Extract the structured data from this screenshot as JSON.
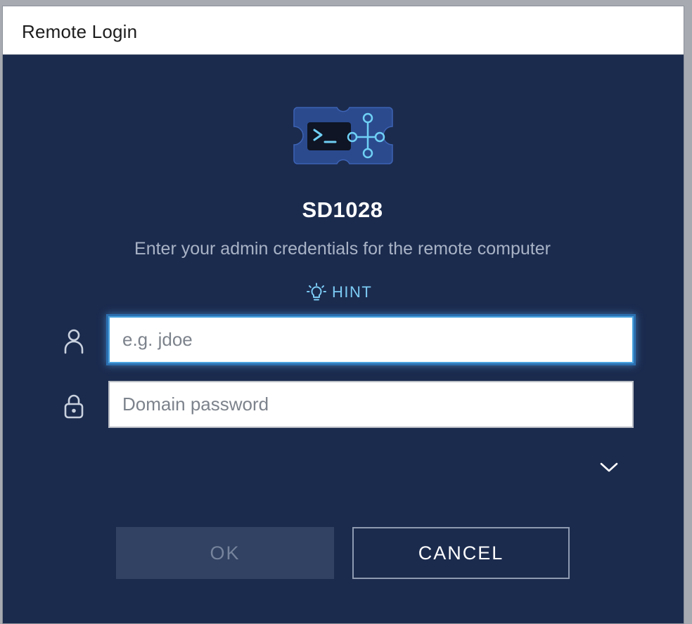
{
  "window": {
    "title": "Remote Login"
  },
  "dialog": {
    "logo_icon": "remote-terminal-network-icon",
    "host_name": "SD1028",
    "subtitle": "Enter your admin credentials for the remote computer",
    "hint": {
      "icon": "lightbulb-icon",
      "label": "HINT"
    },
    "username": {
      "icon": "person-icon",
      "value": "",
      "placeholder": "e.g. jdoe"
    },
    "password": {
      "icon": "lock-icon",
      "value": "",
      "placeholder": "Domain password"
    },
    "expand_icon": "chevron-down-icon",
    "ok_label": "OK",
    "cancel_label": "CANCEL"
  },
  "colors": {
    "background": "#1b2b4e",
    "accent": "#7ccbf4",
    "focus_ring": "#4aa3df",
    "disabled_button": "#314262"
  }
}
